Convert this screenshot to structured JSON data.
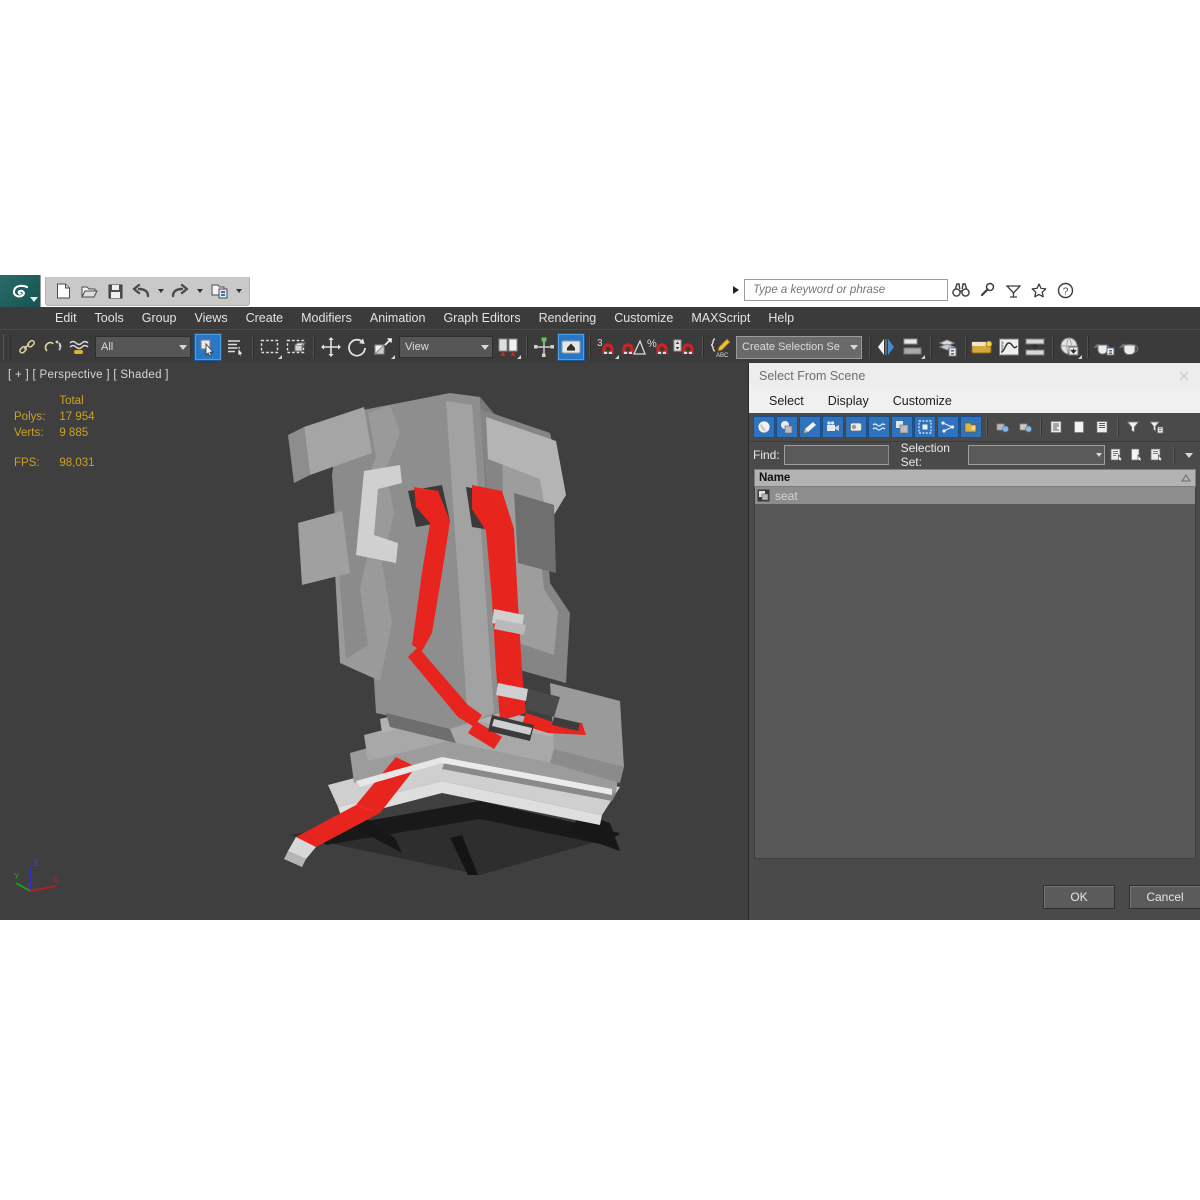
{
  "app": {
    "name": "3ds Max",
    "quick_access": [
      {
        "name": "new-file-button",
        "icon": "new-file-icon"
      },
      {
        "name": "open-file-button",
        "icon": "open-folder-icon"
      },
      {
        "name": "save-file-button",
        "icon": "save-disk-icon"
      },
      {
        "name": "undo-button",
        "icon": "undo-arrow-icon"
      },
      {
        "name": "undo-dropdown",
        "icon": "chevron-down-icon"
      },
      {
        "name": "redo-button",
        "icon": "redo-arrow-icon"
      },
      {
        "name": "redo-dropdown",
        "icon": "chevron-down-icon"
      },
      {
        "name": "project-folder-button",
        "icon": "project-folder-icon"
      },
      {
        "name": "qat-overflow-button",
        "icon": "chevron-down-icon"
      }
    ]
  },
  "search": {
    "placeholder": "Type a keyword or phrase",
    "value": "",
    "icons": [
      "binoculars-icon",
      "wrench-icon",
      "satellite-dish-icon",
      "star-icon",
      "help-icon"
    ]
  },
  "menubar": {
    "items": [
      {
        "label": "Edit"
      },
      {
        "label": "Tools"
      },
      {
        "label": "Group"
      },
      {
        "label": "Views"
      },
      {
        "label": "Create"
      },
      {
        "label": "Modifiers"
      },
      {
        "label": "Animation"
      },
      {
        "label": "Graph Editors"
      },
      {
        "label": "Rendering"
      },
      {
        "label": "Customize"
      },
      {
        "label": "MAXScript"
      },
      {
        "label": "Help"
      }
    ]
  },
  "toolbar": {
    "selection_filter": "All",
    "reference_coord_system": "View",
    "named_selection_sets": "Create Selection Se",
    "buttons": [
      {
        "name": "select-and-link-button",
        "icon": "link-icon"
      },
      {
        "name": "unlink-selection-button",
        "icon": "unlink-icon"
      },
      {
        "name": "bind-to-space-warp-button",
        "icon": "space-warp-icon"
      },
      {
        "name": "select-object-button",
        "icon": "select-arrow-icon",
        "active": true
      },
      {
        "name": "select-by-name-button",
        "icon": "select-by-name-icon"
      },
      {
        "name": "rectangular-selection-region-button",
        "icon": "rectangle-select-icon"
      },
      {
        "name": "window-crossing-toggle-button",
        "icon": "window-crossing-icon"
      },
      {
        "name": "select-and-move-button",
        "icon": "move-icon"
      },
      {
        "name": "select-and-rotate-button",
        "icon": "rotate-icon"
      },
      {
        "name": "select-and-scale-button",
        "icon": "scale-icon"
      },
      {
        "name": "use-pivot-point-center-button",
        "icon": "pivot-center-icon"
      },
      {
        "name": "select-and-manipulate-button",
        "icon": "manipulate-icon"
      },
      {
        "name": "snaps-toggle-button",
        "icon": "snap-3-icon",
        "active": true
      },
      {
        "name": "angle-snap-toggle-button",
        "icon": "angle-snap-icon"
      },
      {
        "name": "percent-snap-toggle-button",
        "icon": "percent-snap-icon"
      },
      {
        "name": "spinner-snap-toggle-button",
        "icon": "spinner-snap-icon"
      },
      {
        "name": "edit-named-selection-sets-button",
        "icon": "named-sets-icon"
      },
      {
        "name": "mirror-button",
        "icon": "mirror-icon"
      },
      {
        "name": "align-button",
        "icon": "align-icon"
      },
      {
        "name": "layer-explorer-button",
        "icon": "layers-icon"
      },
      {
        "name": "toggle-ribbon-button",
        "icon": "ribbon-icon"
      },
      {
        "name": "curve-editor-button",
        "icon": "curve-editor-icon"
      },
      {
        "name": "schematic-view-button",
        "icon": "schematic-view-icon"
      },
      {
        "name": "material-editor-button",
        "icon": "material-globe-icon"
      },
      {
        "name": "render-setup-button",
        "icon": "teapot-render-icon"
      },
      {
        "name": "rendered-frame-window-button",
        "icon": "teapot-frame-icon"
      }
    ]
  },
  "viewport": {
    "label": "[ + ] [ Perspective ] [ Shaded ]",
    "stats": {
      "header": "Total",
      "rows": [
        {
          "label": "Polys:",
          "value": "17 954"
        },
        {
          "label": "Verts:",
          "value": "9 885"
        }
      ],
      "fps_label": "FPS:",
      "fps_value": "98,031"
    },
    "axes": {
      "x": "X",
      "y": "Y",
      "z": "Z"
    },
    "scene_object": "racing seat with red harness"
  },
  "dialog": {
    "title": "Select From Scene",
    "close_icon": "close-icon",
    "menu": [
      {
        "label": "Select"
      },
      {
        "label": "Display"
      },
      {
        "label": "Customize"
      }
    ],
    "filter_buttons": [
      {
        "name": "display-geometry-toggle",
        "icon": "sphere-icon",
        "active": true
      },
      {
        "name": "display-shapes-toggle",
        "icon": "shapes-icon",
        "active": true
      },
      {
        "name": "display-lights-toggle",
        "icon": "light-icon",
        "active": true
      },
      {
        "name": "display-cameras-toggle",
        "icon": "camera-icon",
        "active": true
      },
      {
        "name": "display-helpers-toggle",
        "icon": "tape-measure-icon",
        "active": true
      },
      {
        "name": "display-space-warps-toggle",
        "icon": "space-warp-waves-icon",
        "active": true
      },
      {
        "name": "display-groups-toggle",
        "icon": "group-icon",
        "active": true
      },
      {
        "name": "display-xrefs-toggle",
        "icon": "xref-icon",
        "active": true
      },
      {
        "name": "display-bones-toggle",
        "icon": "bone-chain-icon",
        "active": true
      },
      {
        "name": "display-containers-toggle",
        "icon": "container-icon",
        "active": true
      },
      {
        "name": "display-frozen-toggle",
        "icon": "frozen-object-icon",
        "active": false
      },
      {
        "name": "display-hidden-toggle",
        "icon": "hidden-object-icon",
        "active": false
      },
      {
        "name": "expand-all-button",
        "icon": "list-lines-icon",
        "active": false
      },
      {
        "name": "collapse-all-button",
        "icon": "blank-page-icon",
        "active": false
      },
      {
        "name": "list-types-button",
        "icon": "list-page-icon",
        "active": false
      },
      {
        "name": "filter-button",
        "icon": "funnel-icon",
        "active": false
      },
      {
        "name": "filter-settings-button",
        "icon": "funnel-settings-icon",
        "active": false
      }
    ],
    "find": {
      "label": "Find:",
      "value": "",
      "placeholder": ""
    },
    "selection_set": {
      "label": "Selection Set:",
      "value": "",
      "dropdown_icon": "chevron-down-icon"
    },
    "set_buttons": [
      {
        "name": "select-subtree-button",
        "icon": "subtree-icon"
      },
      {
        "name": "select-influences-button",
        "icon": "influences-icon"
      },
      {
        "name": "select-dependents-button",
        "icon": "dependents-icon"
      },
      {
        "name": "more-options-button",
        "icon": "chevron-down-icon"
      }
    ],
    "list": {
      "column_header": "Name",
      "sort_icon": "sort-ascending-icon",
      "rows": [
        {
          "name": "seat",
          "icon": "geometry-object-icon",
          "selected": true
        }
      ]
    },
    "footer": {
      "ok_label": "OK",
      "cancel_label": "Cancel"
    }
  },
  "colors": {
    "accent_blue": "#2878c8",
    "viewport_bg": "#3f3f3f",
    "panel_bg": "#3b3b3b",
    "stats_yellow": "#c9a227",
    "harness_red": "#e8241f"
  }
}
